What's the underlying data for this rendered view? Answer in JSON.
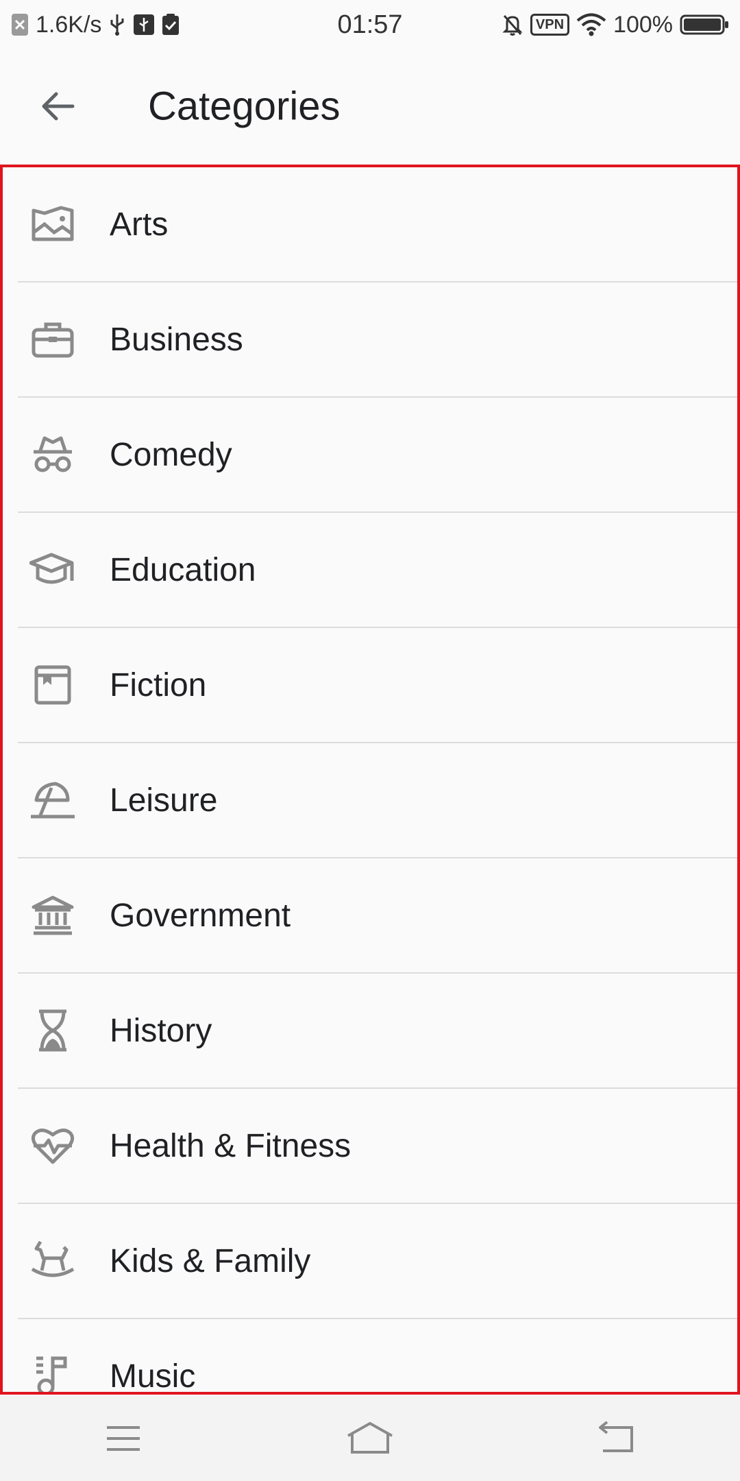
{
  "status_bar": {
    "speed": "1.6K/s",
    "time": "01:57",
    "vpn": "VPN",
    "battery": "100%"
  },
  "app_bar": {
    "title": "Categories"
  },
  "categories": [
    {
      "label": "Arts",
      "icon": "image-icon"
    },
    {
      "label": "Business",
      "icon": "briefcase-icon"
    },
    {
      "label": "Comedy",
      "icon": "disguise-icon"
    },
    {
      "label": "Education",
      "icon": "graduation-cap-icon"
    },
    {
      "label": "Fiction",
      "icon": "book-icon"
    },
    {
      "label": "Leisure",
      "icon": "beach-umbrella-icon"
    },
    {
      "label": "Government",
      "icon": "government-building-icon"
    },
    {
      "label": "History",
      "icon": "hourglass-icon"
    },
    {
      "label": "Health & Fitness",
      "icon": "heart-pulse-icon"
    },
    {
      "label": "Kids & Family",
      "icon": "rocking-horse-icon"
    },
    {
      "label": "Music",
      "icon": "music-note-icon"
    }
  ],
  "colors": {
    "highlight_border": "#e0141e",
    "icon_gray": "#8a8a8a",
    "divider": "#dcdcdc"
  }
}
